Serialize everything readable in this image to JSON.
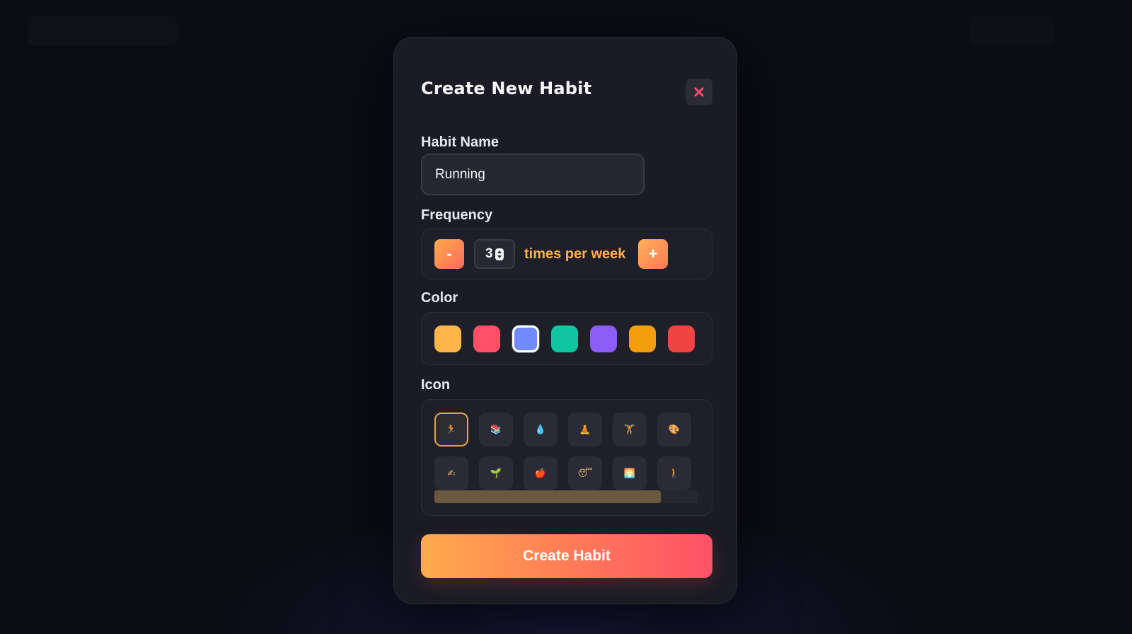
{
  "modal": {
    "title": "Create New Habit",
    "close_icon": "close-icon",
    "close_color": "#ff4d6a"
  },
  "habit_name": {
    "label": "Habit Name",
    "value": "Running"
  },
  "frequency": {
    "label": "Frequency",
    "minus_label": "-",
    "value": "3",
    "unit_text": "times per week",
    "plus_label": "+"
  },
  "color": {
    "label": "Color",
    "swatches": [
      {
        "hex": "#ffb547",
        "selected": false
      },
      {
        "hex": "#ff4f68",
        "selected": false
      },
      {
        "hex": "#6f8bff",
        "selected": true
      },
      {
        "hex": "#0fc6a0",
        "selected": false
      },
      {
        "hex": "#8b5cf6",
        "selected": false
      },
      {
        "hex": "#f59e0b",
        "selected": false
      },
      {
        "hex": "#ef4444",
        "selected": false
      }
    ]
  },
  "icon": {
    "label": "Icon",
    "options": [
      {
        "glyph": "🏃",
        "name": "running-icon",
        "selected": true
      },
      {
        "glyph": "📚",
        "name": "books-icon",
        "selected": false
      },
      {
        "glyph": "💧",
        "name": "water-drop-icon",
        "selected": false
      },
      {
        "glyph": "🧘",
        "name": "meditation-icon",
        "selected": false
      },
      {
        "glyph": "🏋",
        "name": "weightlifting-icon",
        "selected": false
      },
      {
        "glyph": "🎨",
        "name": "palette-icon",
        "selected": false
      },
      {
        "glyph": "✍",
        "name": "writing-icon",
        "selected": false
      },
      {
        "glyph": "🌱",
        "name": "seedling-icon",
        "selected": false
      },
      {
        "glyph": "🍎",
        "name": "apple-icon",
        "selected": false
      },
      {
        "glyph": "😴",
        "name": "sleep-icon",
        "selected": false
      },
      {
        "glyph": "🌅",
        "name": "sunrise-icon",
        "selected": false
      },
      {
        "glyph": "🚶",
        "name": "walking-icon",
        "selected": false
      }
    ],
    "scroll_progress": 0.86
  },
  "submit": {
    "label": "Create Habit"
  }
}
